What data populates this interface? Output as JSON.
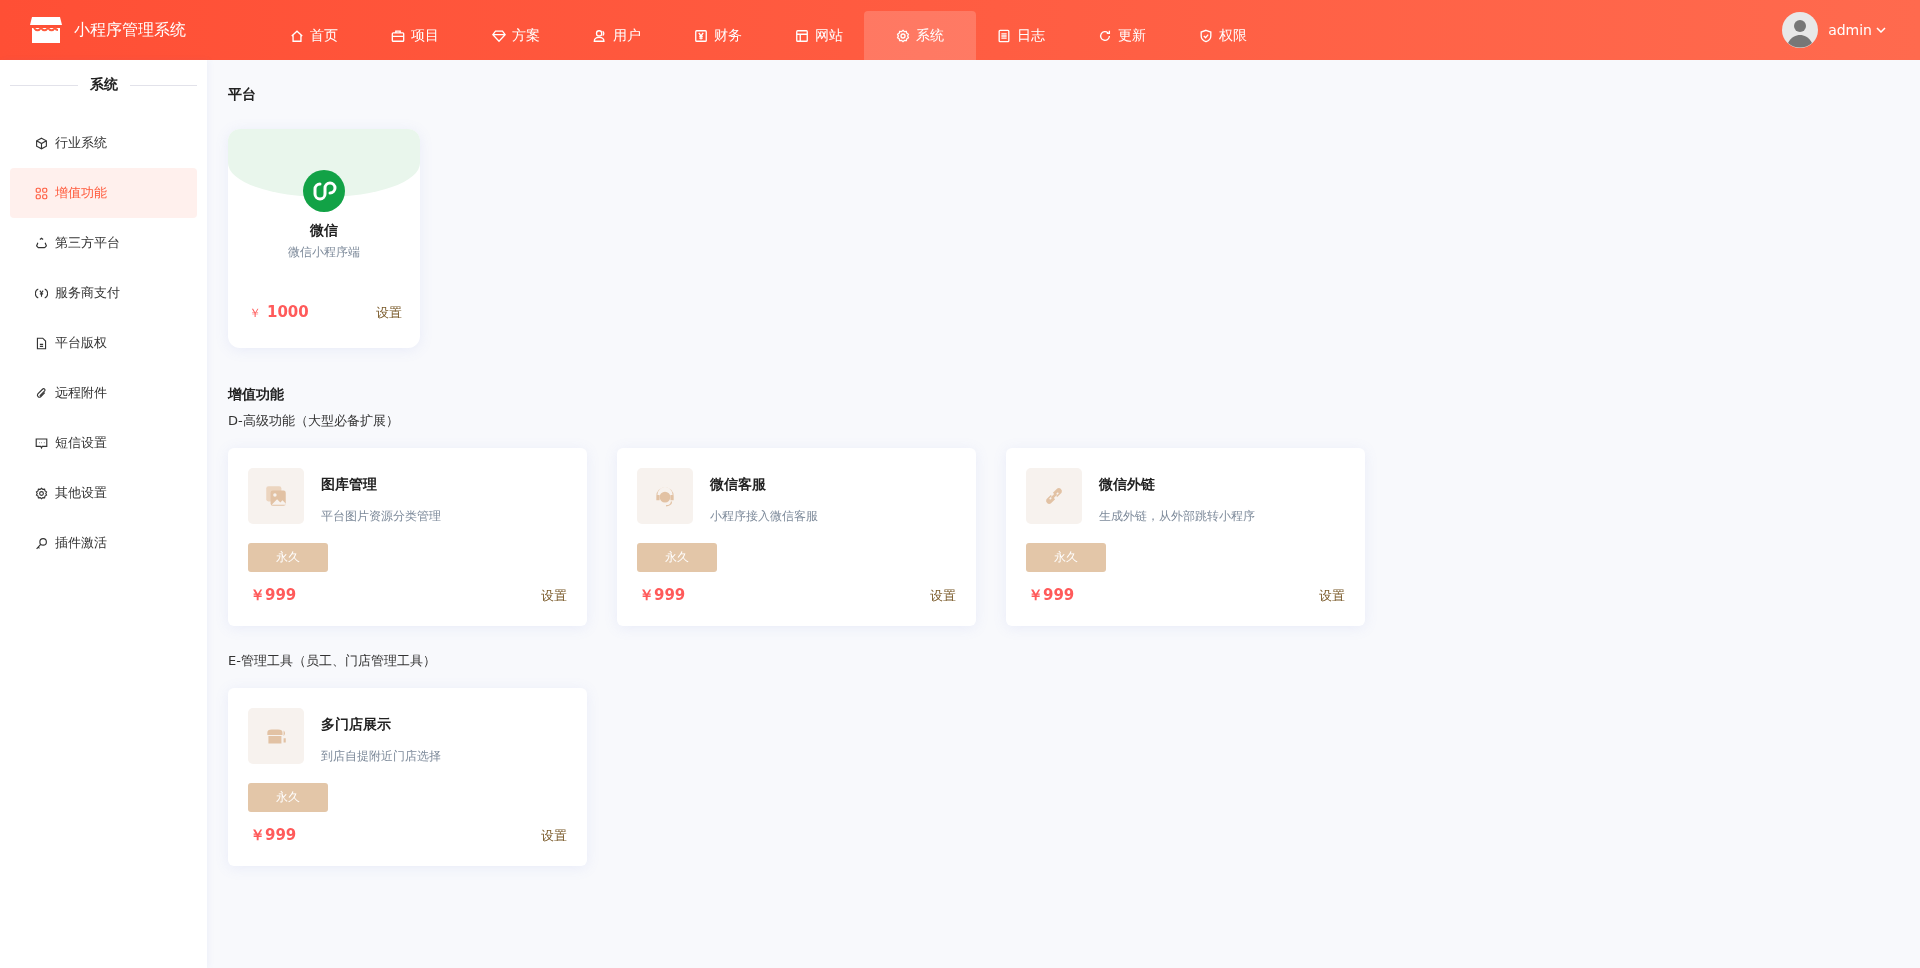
{
  "header": {
    "app_title": "小程序管理系统",
    "nav": [
      {
        "label": "首页",
        "selected": false
      },
      {
        "label": "项目",
        "selected": false
      },
      {
        "label": "方案",
        "selected": false
      },
      {
        "label": "用户",
        "selected": false
      },
      {
        "label": "财务",
        "selected": false
      },
      {
        "label": "网站",
        "selected": false
      },
      {
        "label": "系统",
        "selected": true
      },
      {
        "label": "日志",
        "selected": false
      },
      {
        "label": "更新",
        "selected": false
      },
      {
        "label": "权限",
        "selected": false
      }
    ],
    "user": {
      "name": "admin"
    }
  },
  "sidebar": {
    "title": "系统",
    "items": [
      {
        "label": "行业系统",
        "selected": false
      },
      {
        "label": "增值功能",
        "selected": true
      },
      {
        "label": "第三方平台",
        "selected": false
      },
      {
        "label": "服务商支付",
        "selected": false
      },
      {
        "label": "平台版权",
        "selected": false
      },
      {
        "label": "远程附件",
        "selected": false
      },
      {
        "label": "短信设置",
        "selected": false
      },
      {
        "label": "其他设置",
        "selected": false
      },
      {
        "label": "插件激活",
        "selected": false
      }
    ]
  },
  "platform": {
    "title": "平台",
    "cards": [
      {
        "name": "微信",
        "description": "微信小程序端",
        "currency": "￥",
        "price": "1000",
        "action": "设置"
      }
    ]
  },
  "addons": {
    "title": "增值功能",
    "groups": [
      {
        "title": "D-高级功能（大型必备扩展）",
        "cards": [
          {
            "name": "图库管理",
            "description": "平台图片资源分类管理",
            "tag": "永久",
            "price": "￥999",
            "action": "设置"
          },
          {
            "name": "微信客服",
            "description": "小程序接入微信客服",
            "tag": "永久",
            "price": "￥999",
            "action": "设置"
          },
          {
            "name": "微信外链",
            "description": "生成外链，从外部跳转小程序",
            "tag": "永久",
            "price": "￥999",
            "action": "设置"
          }
        ]
      },
      {
        "title": "E-管理工具（员工、门店管理工具）",
        "cards": [
          {
            "name": "多门店展示",
            "description": "到店自提附近门店选择",
            "tag": "永久",
            "price": "￥999",
            "action": "设置"
          }
        ]
      }
    ]
  }
}
